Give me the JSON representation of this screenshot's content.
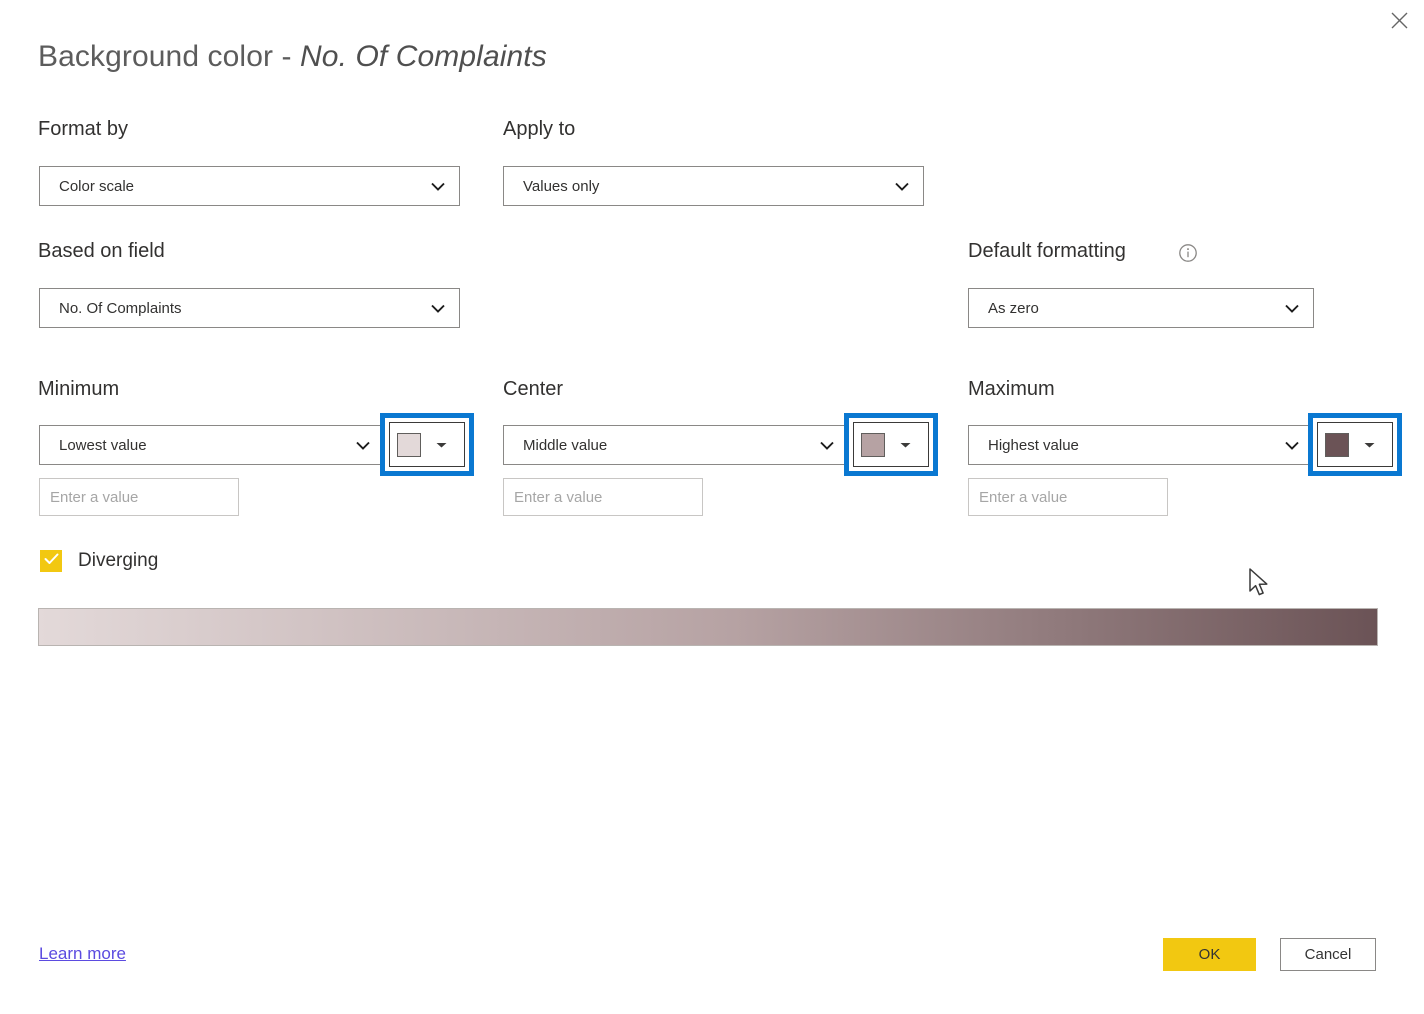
{
  "dialog": {
    "title_prefix": "Background color - ",
    "title_field": "No. Of Complaints",
    "close_label": "✕"
  },
  "format_by": {
    "label": "Format by",
    "value": "Color scale"
  },
  "apply_to": {
    "label": "Apply to",
    "value": "Values only"
  },
  "based_on_field": {
    "label": "Based on field",
    "value": "No. Of Complaints"
  },
  "default_formatting": {
    "label": "Default formatting",
    "value": "As zero",
    "info_icon": "info-icon"
  },
  "minimum": {
    "label": "Minimum",
    "value": "Lowest value",
    "input_placeholder": "Enter a value",
    "input_value": "",
    "color": "#e3d9d9"
  },
  "center": {
    "label": "Center",
    "value": "Middle value",
    "input_placeholder": "Enter a value",
    "input_value": "",
    "color": "#b6a2a3"
  },
  "maximum": {
    "label": "Maximum",
    "value": "Highest value",
    "input_placeholder": "Enter a value",
    "input_value": "",
    "color": "#6b5356"
  },
  "diverging": {
    "label": "Diverging",
    "checked": true,
    "check_glyph": "✓",
    "accent": "#f2c811"
  },
  "gradient": {
    "from": "#e3d9d9",
    "mid": "#b6a2a3",
    "to": "#6b5356"
  },
  "footer": {
    "learn_more": "Learn more",
    "ok": "OK",
    "cancel": "Cancel"
  },
  "focus_ring_color": "#0a78d1"
}
